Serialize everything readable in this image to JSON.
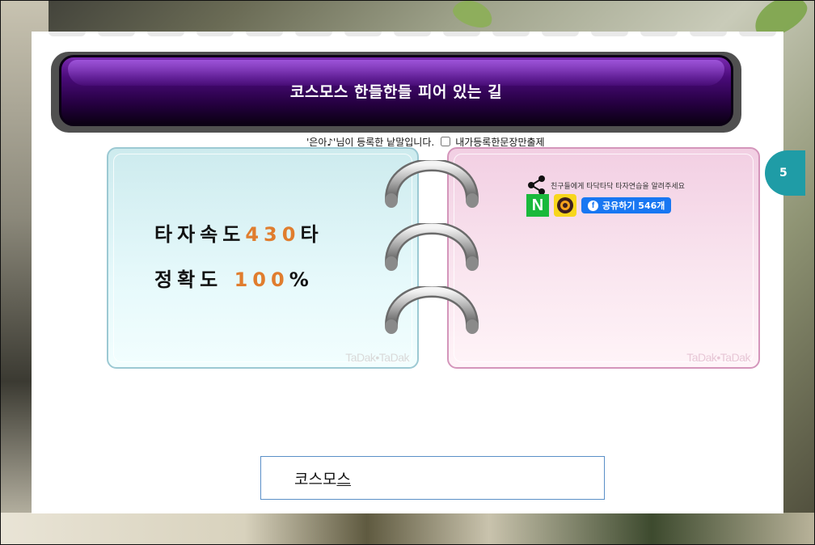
{
  "title": "코스모스 한들한들 피어 있는 길",
  "registered": {
    "text": "'은아♪'님이 등록한 낱말입니다.",
    "checkbox_label": "내가등록한문장만출제",
    "checked": false
  },
  "stats": {
    "speed_label": "타자속도",
    "speed_value": "430",
    "speed_unit": "타",
    "accuracy_label": "정확도",
    "accuracy_value": "100",
    "accuracy_unit": "%"
  },
  "watermark": "TaDak•TaDak",
  "share": {
    "message": "친구들에게 타닥타닥 타자연습을 알려주세요",
    "naver_label": "N",
    "facebook_label": "공유하기 546개",
    "facebook_icon": "f"
  },
  "side_tab": "5",
  "input": {
    "typed_text": "코스모",
    "composing_char": "스"
  },
  "colors": {
    "title_bg": "#250040",
    "stat_number": "#e07d2e",
    "left_card_border": "#9cc9d3",
    "right_card_border": "#d496bb",
    "naver_green": "#19b93b",
    "kakao_yellow": "#f7d61c",
    "facebook_blue": "#1877f2",
    "side_tab_teal": "#1f9ca6"
  }
}
